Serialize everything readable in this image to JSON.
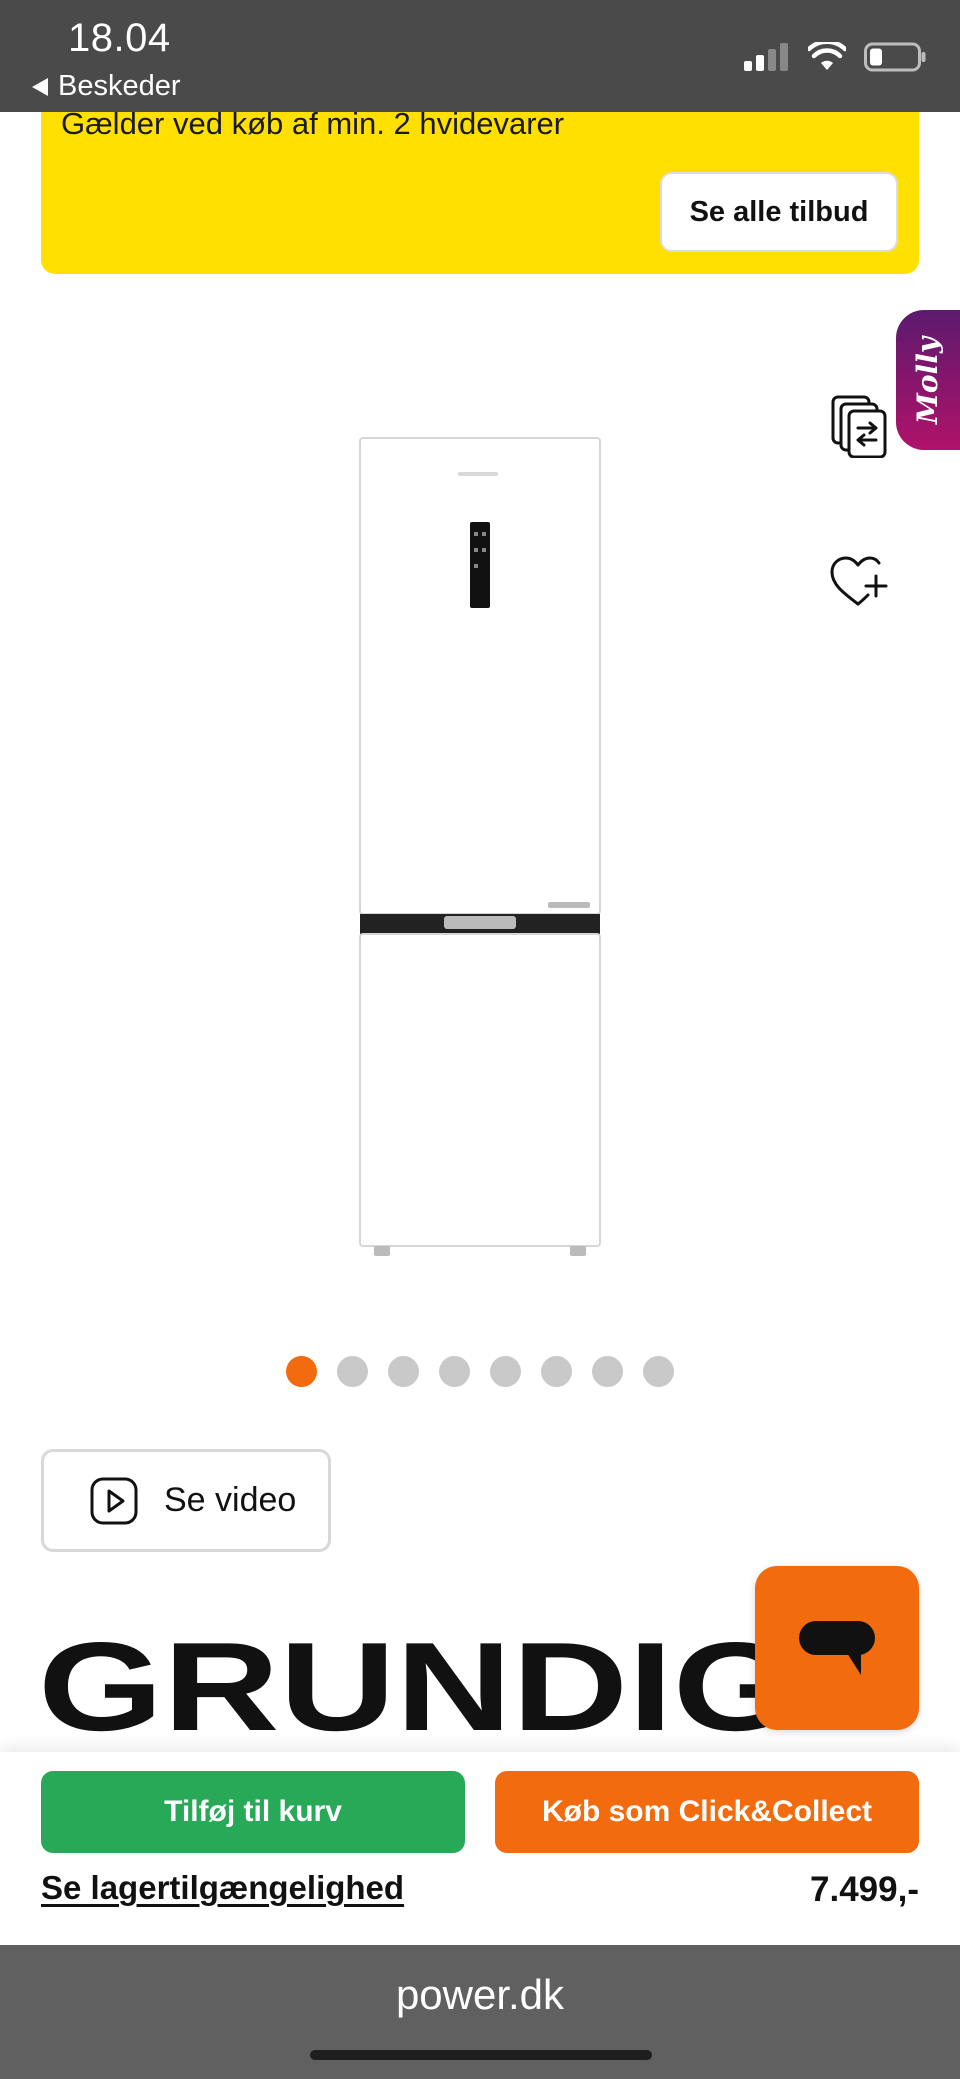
{
  "status_bar": {
    "time": "18.04",
    "back_label": "Beskeder"
  },
  "promo": {
    "text": "Gælder ved køb af min. 2 hvidevarer",
    "button_label": "Se alle tilbud",
    "color": "#ffe000"
  },
  "assistant_tab": {
    "label": "Molly"
  },
  "gallery": {
    "dot_count": 8,
    "active_index": 0
  },
  "video_button": {
    "label": "Se video",
    "icon": "play-icon"
  },
  "brand": {
    "name": "GRUNDIG"
  },
  "actions": {
    "add_to_cart_label": "Tilføj til kurv",
    "click_collect_label": "Køb som Click&Collect",
    "stock_link": "Se lagertilgængelighed",
    "price": "7.499,-",
    "cart_color": "#27a957",
    "accent_color": "#f26b0f"
  },
  "browser": {
    "url": "power.dk"
  }
}
